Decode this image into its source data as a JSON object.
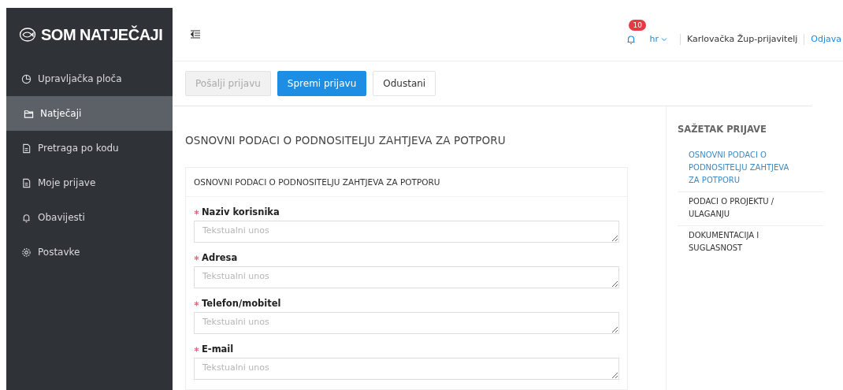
{
  "logo": {
    "text": "SOM NATJEČAJI"
  },
  "sidebar": {
    "items": [
      {
        "label": "Upravljačka ploča",
        "kind": "chart",
        "selected": false
      },
      {
        "label": "Natječaji",
        "kind": "folder",
        "selected": true
      },
      {
        "label": "Pretraga po kodu",
        "kind": "doc",
        "selected": false
      },
      {
        "label": "Moje prijave",
        "kind": "doc",
        "selected": false
      },
      {
        "label": "Obavijesti",
        "kind": "bell",
        "selected": false
      },
      {
        "label": "Postavke",
        "kind": "gear",
        "selected": false
      }
    ]
  },
  "header": {
    "notifications": "10",
    "language": "hr",
    "user": "Karlovačka Žup-prijavitelj",
    "logout": "Odjava"
  },
  "toolbar": [
    {
      "label": "Pošalji prijavu",
      "kind": "disabled"
    },
    {
      "label": "Spremi prijavu",
      "kind": "primary"
    },
    {
      "label": "Odustani",
      "kind": "default"
    }
  ],
  "form": {
    "title": "OSNOVNI PODACI O PODNOSITELJU ZAHTJEVA ZA POTPORU",
    "card_title": "OSNOVNI PODACI O PODNOSITELJU ZAHTJEVA ZA POTPORU",
    "fields": [
      {
        "label": "Naziv korisnika",
        "required": true,
        "placeholder": "Tekstualni unos"
      },
      {
        "label": "Adresa",
        "required": true,
        "placeholder": "Tekstualni unos"
      },
      {
        "label": "Telefon/mobitel",
        "required": true,
        "placeholder": "Tekstualni unos"
      },
      {
        "label": "E-mail",
        "required": true,
        "placeholder": "Tekstualni unos"
      }
    ]
  },
  "summary": {
    "title": "SAŽETAK PRIJAVE",
    "items": [
      {
        "label": "OSNOVNI PODACI O PODNOSITELJU ZAHTJEVA ZA POTPORU",
        "selected": true
      },
      {
        "label": "PODACI O PROJEKTU / ULAGANJU",
        "selected": false
      },
      {
        "label": "DOKUMENTACIJA I SUGLASNOST",
        "selected": false
      }
    ]
  }
}
